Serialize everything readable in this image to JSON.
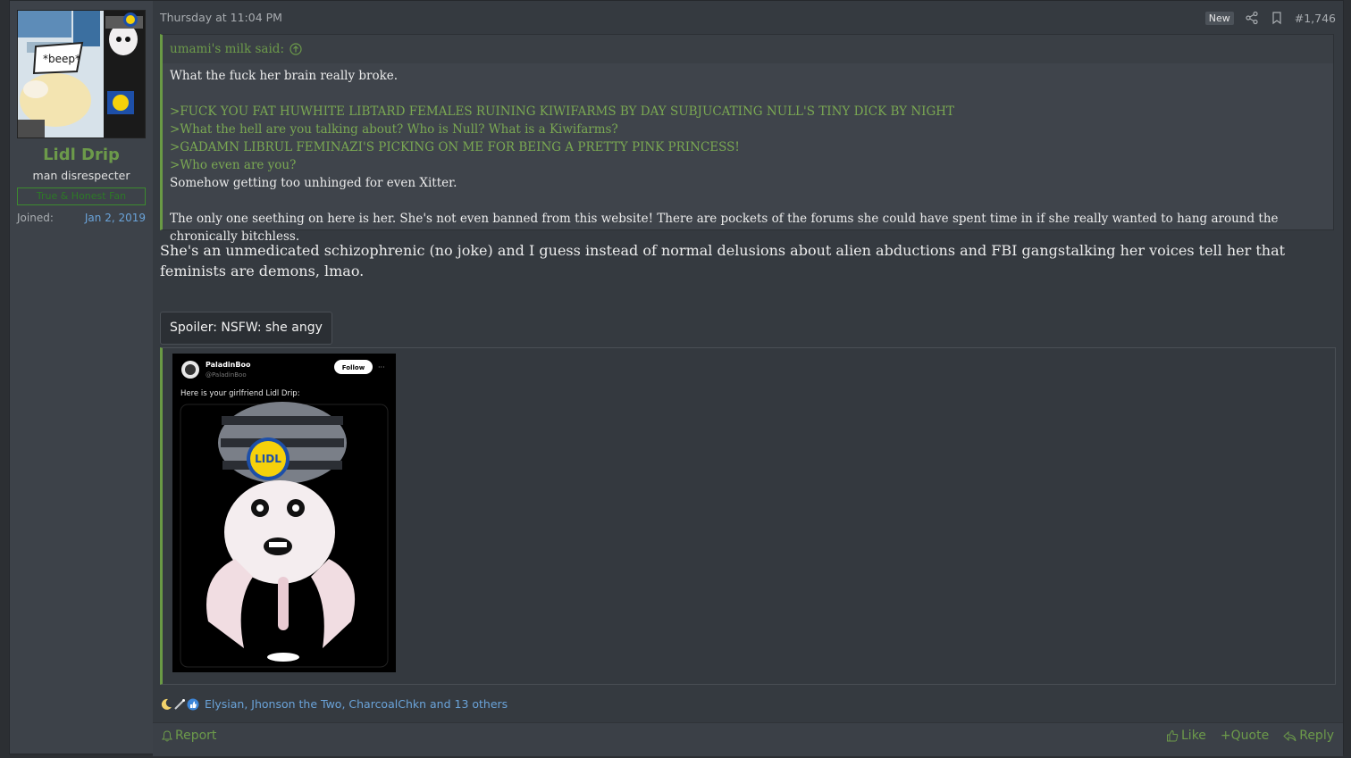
{
  "post": {
    "date": "Thursday at 11:04 PM",
    "new_badge": "New",
    "post_number": "#1,746"
  },
  "user": {
    "name": "Lidl Drip",
    "title": "man disrespecter",
    "banner": "True & Honest Fan",
    "joined_label": "Joined:",
    "joined_date": "Jan 2, 2019",
    "avatar_caption": "*beep*"
  },
  "quote": {
    "author": "umami's milk said:",
    "lines": [
      "What the fuck her brain really broke.",
      ">FUCK YOU FAT HUWHITE LIBTARD FEMALES RUINING KIWIFARMS BY DAY SUBJUCATING NULL'S TINY DICK BY NIGHT",
      ">What the hell are you talking about? Who is Null? What is a Kiwifarms?",
      ">GADAMN LIBRUL FEMINAZI'S PICKING ON ME FOR BEING A PRETTY PINK PRINCESS!",
      ">Who even are you?",
      "Somehow getting too unhinged for even Xitter.",
      "The only one seething on here is her. She's not even banned from this website! There are pockets of the forums she could have spent time in if she really wanted to hang around the chronically bitchless."
    ]
  },
  "message": "She's an unmedicated schizophrenic (no joke) and I guess instead of normal delusions about alien abductions and FBI gangstalking her voices tell her that feminists are demons, lmao.",
  "spoiler": {
    "label": "Spoiler: NSFW: she angy",
    "tweet": {
      "name": "PaladinBoo",
      "handle": "@PaladinBoo",
      "follow": "Follow",
      "text": "Here is your girlfriend Lidl Drip:",
      "logo_text": "LIDL"
    }
  },
  "reactions": {
    "text": "Elysian, Jhonson the Two, CharcoalChkn and 13 others",
    "icons": [
      "moon-icon",
      "wand-icon",
      "thumbs-up-icon"
    ]
  },
  "footer": {
    "report": "Report",
    "like": "Like",
    "quote": "+Quote",
    "reply": "Reply"
  },
  "colors": {
    "accent_green": "#6c9a4a",
    "link_blue": "#6aa3d9",
    "background": "#353a40"
  }
}
